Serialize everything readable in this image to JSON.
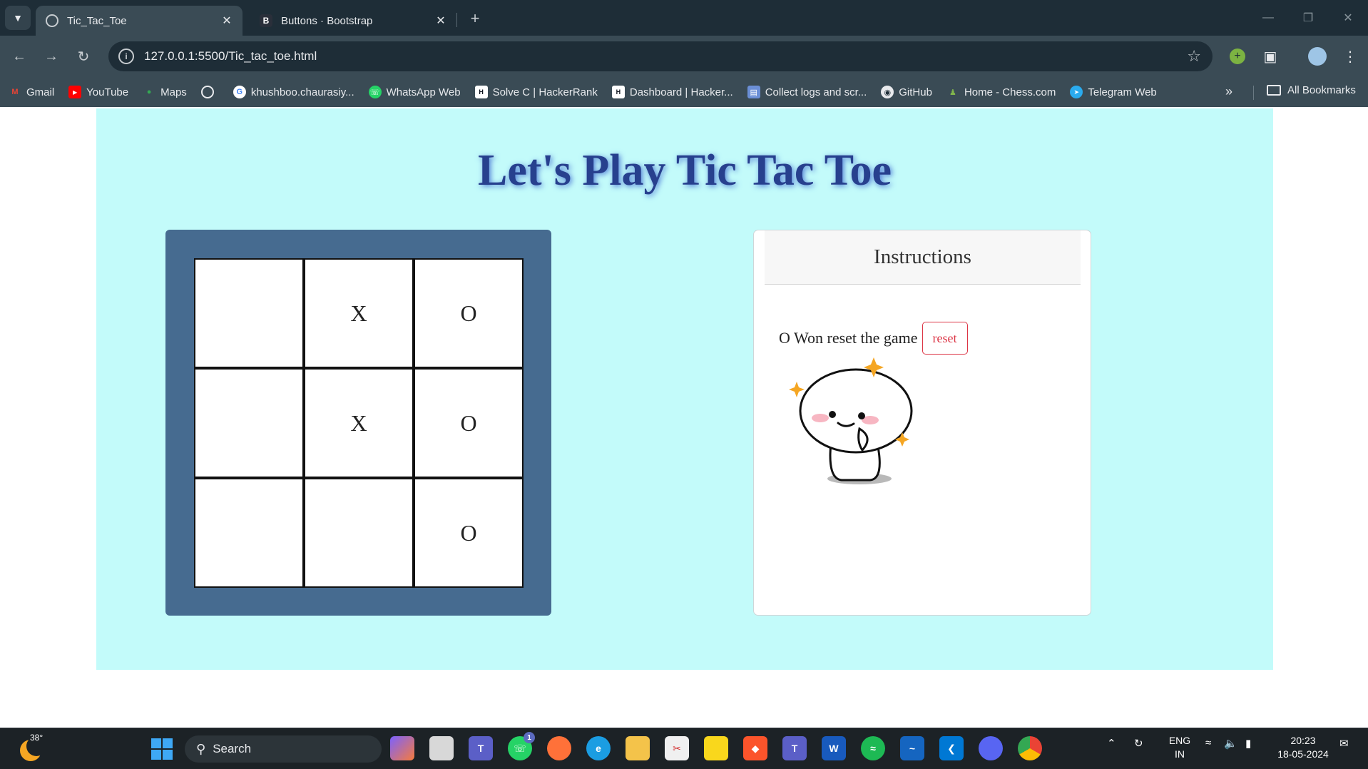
{
  "browser": {
    "tabs": [
      {
        "label": "Tic_Tac_Toe",
        "icon": "globe-icon",
        "active": true
      },
      {
        "label": "Buttons · Bootstrap",
        "icon": "bootstrap-icon",
        "active": false
      }
    ],
    "url": "127.0.0.1:5500/Tic_tac_toe.html",
    "bookmarks": [
      {
        "label": "Gmail",
        "icon": "gmail-icon",
        "color": "#ea4335"
      },
      {
        "label": "YouTube",
        "icon": "youtube-icon",
        "color": "#ff0000"
      },
      {
        "label": "Maps",
        "icon": "maps-icon",
        "color": "#34a853"
      },
      {
        "label": "",
        "icon": "globe-icon",
        "color": "#e8eaed"
      },
      {
        "label": "khushboo.chaurasiy...",
        "icon": "google-icon",
        "color": "#4285f4"
      },
      {
        "label": "WhatsApp Web",
        "icon": "whatsapp-icon",
        "color": "#25d366"
      },
      {
        "label": "Solve C | HackerRank",
        "icon": "hackerrank-icon",
        "color": "#0e141e"
      },
      {
        "label": "Dashboard | Hacker...",
        "icon": "hackerrank-icon",
        "color": "#0e141e"
      },
      {
        "label": "Collect logs and scr...",
        "icon": "log-icon",
        "color": "#6b8fd6"
      },
      {
        "label": "GitHub",
        "icon": "github-icon",
        "color": "#e8eaed"
      },
      {
        "label": "Home - Chess.com",
        "icon": "chess-icon",
        "color": "#81b64c"
      },
      {
        "label": "Telegram Web",
        "icon": "telegram-icon",
        "color": "#2aabee"
      }
    ],
    "all_bookmarks_label": "All Bookmarks"
  },
  "game": {
    "title": "Let's Play Tic Tac Toe",
    "board": [
      [
        "",
        "X",
        "O"
      ],
      [
        "",
        "X",
        "O"
      ],
      [
        "",
        "",
        "O"
      ]
    ]
  },
  "instructions": {
    "header": "Instructions",
    "status": "O Won reset the game",
    "reset_label": "reset"
  },
  "taskbar": {
    "weather_temp": "38°",
    "search_placeholder": "Search",
    "whatsapp_badge": "1",
    "lang_line1": "ENG",
    "lang_line2": "IN",
    "time": "20:23",
    "date": "18-05-2024"
  }
}
